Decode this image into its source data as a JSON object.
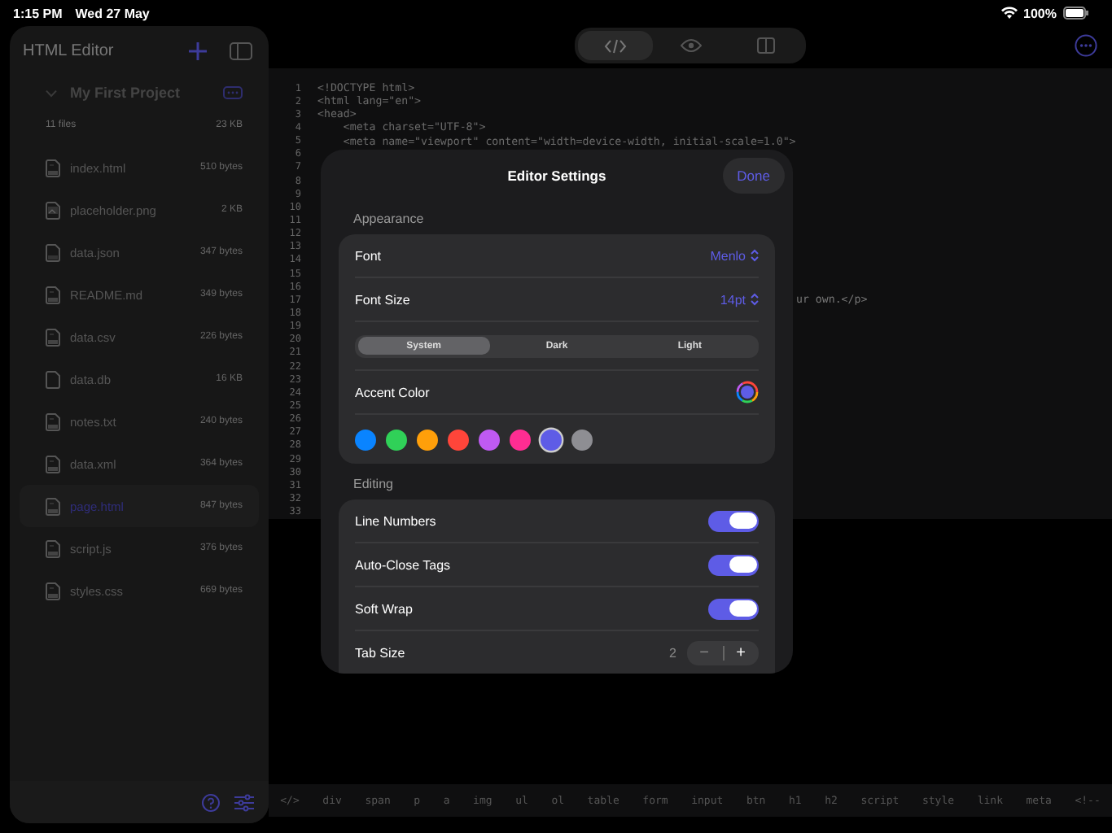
{
  "status_bar": {
    "time": "1:15 PM",
    "date": "Wed 27 May",
    "battery": "100%"
  },
  "sidebar": {
    "title": "HTML Editor",
    "project": {
      "name": "My First Project",
      "expanded": true
    },
    "summary": {
      "count": "11 files",
      "size": "23 KB"
    },
    "files": [
      {
        "name": "index.html",
        "size": "510 bytes",
        "kind": "code",
        "selected": false
      },
      {
        "name": "placeholder.png",
        "size": "2 KB",
        "kind": "image",
        "selected": false
      },
      {
        "name": "data.json",
        "size": "347 bytes",
        "kind": "plain",
        "selected": false
      },
      {
        "name": "README.md",
        "size": "349 bytes",
        "kind": "code",
        "selected": false
      },
      {
        "name": "data.csv",
        "size": "226 bytes",
        "kind": "code",
        "selected": false
      },
      {
        "name": "data.db",
        "size": "16 KB",
        "kind": "blank",
        "selected": false
      },
      {
        "name": "notes.txt",
        "size": "240 bytes",
        "kind": "code",
        "selected": false
      },
      {
        "name": "data.xml",
        "size": "364 bytes",
        "kind": "code",
        "selected": false
      },
      {
        "name": "page.html",
        "size": "847 bytes",
        "kind": "code",
        "selected": true
      },
      {
        "name": "script.js",
        "size": "376 bytes",
        "kind": "code",
        "selected": false
      },
      {
        "name": "styles.css",
        "size": "669 bytes",
        "kind": "code",
        "selected": false
      }
    ]
  },
  "toolbar": {
    "modes": [
      {
        "kind": "code",
        "selected": true
      },
      {
        "kind": "preview",
        "selected": false
      },
      {
        "kind": "split",
        "selected": false
      }
    ]
  },
  "editor": {
    "lines": [
      {
        "number": "1",
        "kind": "full",
        "text": "<!DOCTYPE html>"
      },
      {
        "number": "2",
        "kind": "full",
        "text": "<html lang=\"en\">"
      },
      {
        "number": "3",
        "kind": "full",
        "text": "<head>"
      },
      {
        "number": "4",
        "kind": "full",
        "text": "    <meta charset=\"UTF-8\">"
      },
      {
        "number": "5",
        "kind": "full",
        "text": "    <meta name=\"viewport\" content=\"width=device-width, initial-scale=1.0\">"
      },
      {
        "number": "6"
      },
      {
        "number": "7"
      },
      {
        "number": "8"
      },
      {
        "number": "9"
      },
      {
        "number": "10"
      },
      {
        "number": "11"
      },
      {
        "number": "12"
      },
      {
        "number": "13"
      },
      {
        "number": "14"
      },
      {
        "number": "15"
      },
      {
        "number": "16"
      },
      {
        "number": "17",
        "kind": "covered",
        "text": "ur own.</p>"
      },
      {
        "number": "18"
      },
      {
        "number": "19"
      },
      {
        "number": "20"
      },
      {
        "number": "21"
      },
      {
        "number": "22"
      },
      {
        "number": "23"
      },
      {
        "number": "24"
      },
      {
        "number": "25"
      },
      {
        "number": "26"
      },
      {
        "number": "27"
      },
      {
        "number": "28"
      },
      {
        "number": "29"
      },
      {
        "number": "30"
      },
      {
        "number": "31"
      },
      {
        "number": "32"
      },
      {
        "number": "33"
      }
    ]
  },
  "tag_bar": [
    "</>",
    "div",
    "span",
    "p",
    "a",
    "img",
    "ul",
    "ol",
    "table",
    "form",
    "input",
    "btn",
    "h1",
    "h2",
    "script",
    "style",
    "link",
    "meta",
    "<!--"
  ],
  "settings": {
    "title": "Editor Settings",
    "done": "Done",
    "appearance": {
      "heading": "Appearance",
      "font": {
        "label": "Font",
        "value": "Menlo"
      },
      "font_size": {
        "label": "Font Size",
        "value": "14pt"
      },
      "themes": [
        {
          "label": "System",
          "selected": true
        },
        {
          "label": "Dark",
          "selected": false
        },
        {
          "label": "Light",
          "selected": false
        }
      ],
      "accent": {
        "label": "Accent Color"
      },
      "swatches": [
        {
          "color": "#0a84ff",
          "selected": false
        },
        {
          "color": "#30d158",
          "selected": false
        },
        {
          "color": "#ff9f0a",
          "selected": false
        },
        {
          "color": "#ff453a",
          "selected": false
        },
        {
          "color": "#bf5af2",
          "selected": false
        },
        {
          "color": "#ff2d92",
          "selected": false
        },
        {
          "color": "#5e5ce6",
          "selected": true
        },
        {
          "color": "#8e8e93",
          "selected": false
        }
      ]
    },
    "editing": {
      "heading": "Editing",
      "toggles": [
        {
          "label": "Line Numbers",
          "on": true
        },
        {
          "label": "Auto-Close Tags",
          "on": true
        },
        {
          "label": "Soft Wrap",
          "on": true
        }
      ],
      "tab_size": {
        "label": "Tab Size",
        "value": "2",
        "minus": "−",
        "plus": "+"
      }
    }
  }
}
